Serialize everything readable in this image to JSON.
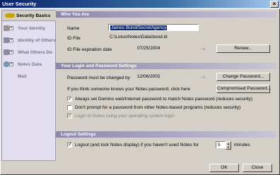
{
  "window": {
    "title": "User Security",
    "close_glyph": "×"
  },
  "sidebar": {
    "items": [
      {
        "label": "Security Basics",
        "expander": "",
        "icon": "key-icon"
      },
      {
        "label": "Your Identity",
        "expander": "+",
        "icon": "id-card-icon"
      },
      {
        "label": "Identity of Others",
        "expander": "+",
        "icon": "people-icon"
      },
      {
        "label": "What Others Do",
        "expander": "+",
        "icon": "people-icon"
      },
      {
        "label": "Notes Data",
        "expander": "+",
        "icon": "database-icon"
      },
      {
        "label": "Mail",
        "expander": "",
        "icon": "mail-icon"
      }
    ]
  },
  "who_you_are": {
    "heading": "Who You Are",
    "name_label": "Name",
    "name_value": "James Bond/SecretAgency",
    "id_file_label": "ID File",
    "id_file_value": "C:\\Lotus\\Notes\\Data\\bond.id",
    "expiration_label": "ID File expiration date",
    "expiration_value": "07/25/2004",
    "renew_button": "Renew..."
  },
  "login_password": {
    "heading": "Your Login and Password Settings",
    "must_change_label": "Password must be changed by",
    "must_change_value": "12/06/2002",
    "change_password_button": "Change Password...",
    "compromised_label": "If you think someone knows your Notes password, click here",
    "compromised_button": "Compromised Password...",
    "options": [
      {
        "label": "Always set Domino web/Internet password to match Notes password (reduces security)",
        "checked": true,
        "enabled": true
      },
      {
        "label": "Don't prompt for a password from other Notes-based programs (reduces security)",
        "checked": false,
        "enabled": true
      },
      {
        "label": "Login to Notes using your operating system login",
        "checked": false,
        "enabled": false
      }
    ]
  },
  "logout": {
    "heading": "Logout Settings",
    "logout_label": "Logout (and lock Notes display) if you haven't used Notes for",
    "logout_checked": true,
    "minutes_value": "5",
    "minutes_label": "minutes"
  },
  "footer": {
    "ok_button": "OK",
    "close_button": "Close"
  }
}
